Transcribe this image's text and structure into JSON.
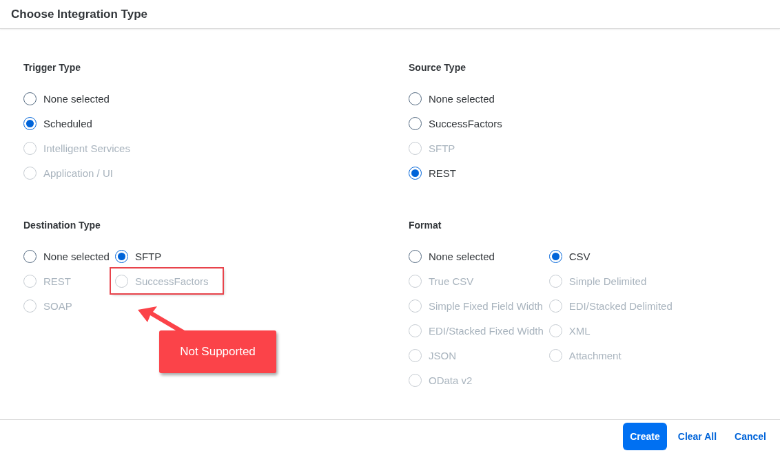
{
  "dialog": {
    "title": "Choose Integration Type"
  },
  "sections": [
    {
      "title": "Trigger Type",
      "columns": [
        [
          {
            "label": "None selected",
            "selected": false,
            "disabled": false,
            "highlighted": false
          },
          {
            "label": "Scheduled",
            "selected": true,
            "disabled": false,
            "highlighted": false
          },
          {
            "label": "Intelligent Services",
            "selected": false,
            "disabled": true,
            "highlighted": false
          },
          {
            "label": "Application / UI",
            "selected": false,
            "disabled": true,
            "highlighted": false
          }
        ]
      ]
    },
    {
      "title": "Source Type",
      "columns": [
        [
          {
            "label": "None selected",
            "selected": false,
            "disabled": false,
            "highlighted": false
          },
          {
            "label": "SuccessFactors",
            "selected": false,
            "disabled": false,
            "highlighted": false
          },
          {
            "label": "SFTP",
            "selected": false,
            "disabled": true,
            "highlighted": false
          },
          {
            "label": "REST",
            "selected": true,
            "disabled": false,
            "highlighted": false
          }
        ]
      ]
    },
    {
      "title": "Destination Type",
      "columns": [
        [
          {
            "label": "None selected",
            "selected": false,
            "disabled": false,
            "highlighted": false
          },
          {
            "label": "REST",
            "selected": false,
            "disabled": true,
            "highlighted": false
          },
          {
            "label": "SOAP",
            "selected": false,
            "disabled": true,
            "highlighted": false
          }
        ],
        [
          {
            "label": "SFTP",
            "selected": true,
            "disabled": false,
            "highlighted": false
          },
          {
            "label": "SuccessFactors",
            "selected": false,
            "disabled": true,
            "highlighted": true
          }
        ]
      ]
    },
    {
      "title": "Format",
      "columns": [
        [
          {
            "label": "None selected",
            "selected": false,
            "disabled": false,
            "highlighted": false
          },
          {
            "label": "True CSV",
            "selected": false,
            "disabled": true,
            "highlighted": false
          },
          {
            "label": "Simple Fixed Field Width",
            "selected": false,
            "disabled": true,
            "highlighted": false
          },
          {
            "label": "EDI/Stacked Fixed Width",
            "selected": false,
            "disabled": true,
            "highlighted": false
          },
          {
            "label": "JSON",
            "selected": false,
            "disabled": true,
            "highlighted": false
          },
          {
            "label": "OData v2",
            "selected": false,
            "disabled": true,
            "highlighted": false
          }
        ],
        [
          {
            "label": "CSV",
            "selected": true,
            "disabled": false,
            "highlighted": false
          },
          {
            "label": "Simple Delimited",
            "selected": false,
            "disabled": true,
            "highlighted": false
          },
          {
            "label": "EDI/Stacked Delimited",
            "selected": false,
            "disabled": true,
            "highlighted": false
          },
          {
            "label": "XML",
            "selected": false,
            "disabled": true,
            "highlighted": false
          },
          {
            "label": "Attachment",
            "selected": false,
            "disabled": true,
            "highlighted": false
          }
        ]
      ]
    }
  ],
  "callout": {
    "text": "Not Supported"
  },
  "buttons": [
    {
      "label": "Create",
      "kind": "primary"
    },
    {
      "label": "Clear All",
      "kind": "link"
    },
    {
      "label": "Cancel",
      "kind": "link"
    }
  ]
}
